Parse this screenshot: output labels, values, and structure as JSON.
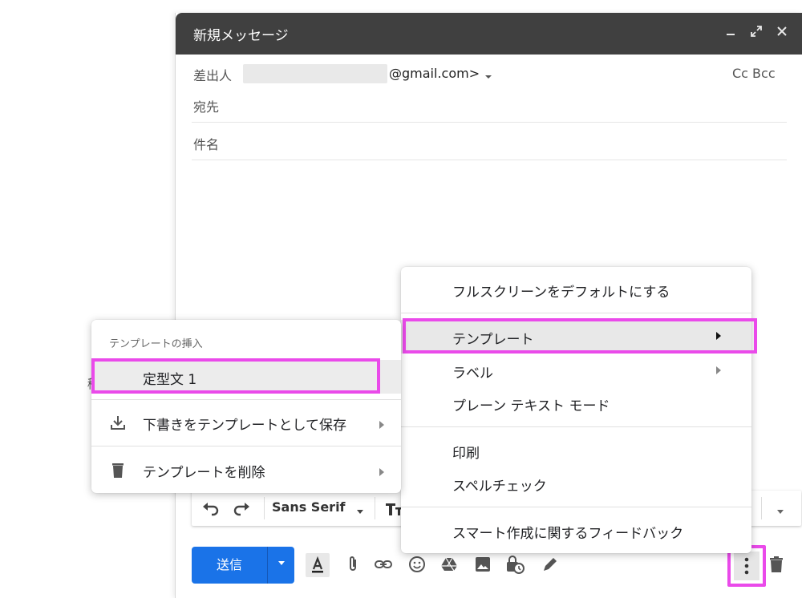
{
  "compose": {
    "title": "新規メッセージ",
    "window_controls": {
      "minimize_icon": "minimize-icon",
      "expand_icon": "expand-icon",
      "close_icon": "close-icon"
    },
    "from_label": "差出人",
    "from_address_suffix": "@gmail.com>",
    "cc_bcc": "Cc Bcc",
    "to_label": "宛先",
    "subject_label": "件名",
    "partial_label": "稀"
  },
  "toolbar": {
    "font_name": "Sans Serif",
    "undo_icon": "undo-icon",
    "redo_icon": "redo-icon",
    "text_size_icon": "text-size-icon"
  },
  "actions": {
    "send_label": "送信",
    "send_options_icon": "dropdown-arrow-icon",
    "text_color_icon": "text-color-icon",
    "attach_icon": "paperclip-icon",
    "link_icon": "link-icon",
    "emoji_icon": "emoji-icon",
    "drive_icon": "drive-icon",
    "photo_icon": "photo-icon",
    "confidential_icon": "confidential-icon",
    "signature_icon": "pen-icon",
    "more_options_icon": "more-vert-icon",
    "discard_icon": "trash-icon"
  },
  "more_menu": {
    "items": [
      "フルスクリーンをデフォルトにする",
      "テンプレート",
      "ラベル",
      "プレーン テキスト モード",
      "印刷",
      "スペルチェック",
      "スマート作成に関するフィードバック"
    ],
    "highlighted": "テンプレート"
  },
  "template_menu": {
    "header": "テンプレートの挿入",
    "template_item": "定型文 1",
    "save_draft": "下書きをテンプレートとして保存",
    "delete": "テンプレートを削除"
  },
  "colors": {
    "highlight": "#ea4aea",
    "send_button": "#1a73e8",
    "titlebar": "#404040"
  }
}
